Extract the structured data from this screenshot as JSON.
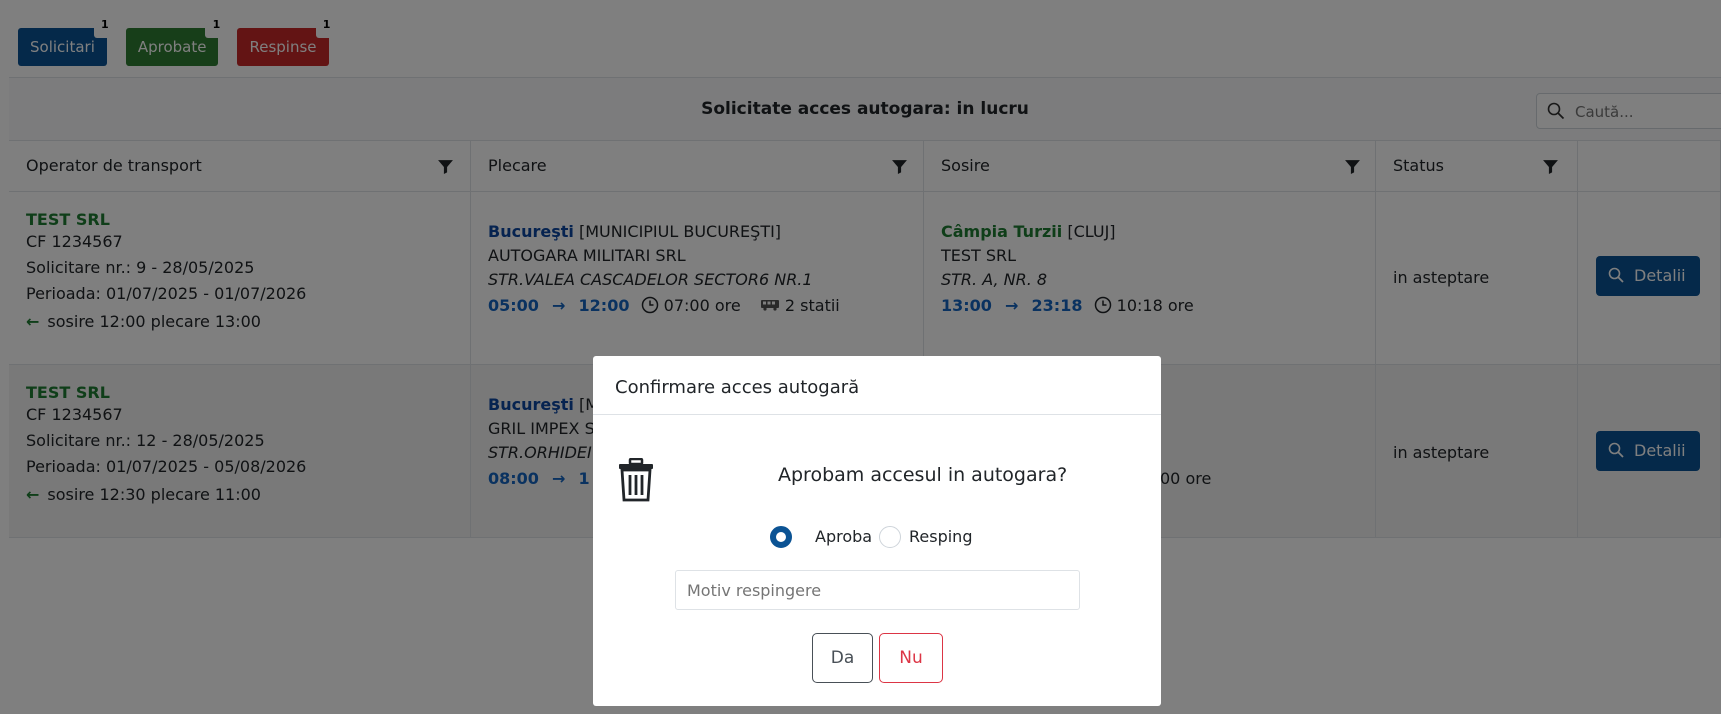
{
  "tabs": [
    {
      "label": "Solicitari",
      "badge": "1",
      "color": "#0b5394"
    },
    {
      "label": "Aprobate",
      "badge": "1",
      "color": "#2e7d32"
    },
    {
      "label": "Respinse",
      "badge": "1",
      "color": "#c62828"
    }
  ],
  "panel": {
    "title": "Solicitate acces autogara: in lucru",
    "search_placeholder": "Caută..."
  },
  "columns": {
    "operator": "Operator de transport",
    "plecare": "Plecare",
    "sosire": "Sosire",
    "status": "Status"
  },
  "rows": [
    {
      "operator": {
        "name": "TEST SRL",
        "cf": "CF 1234567",
        "solicitare": "Solicitare nr.:  9  -  28/05/2025",
        "perioada": "Perioada:  01/07/2025  -  01/07/2026",
        "arrow": "←",
        "sosire_plecare": "sosire 12:00 plecare 13:00"
      },
      "plecare": {
        "city": "Bucureşti",
        "county": " [MUNICIPIUL BUCUREŞTI]",
        "company": "AUTOGARA MILITARI SRL",
        "address": "STR.VALEA CASCADELOR SECTOR6 NR.1",
        "time_from": "05:00",
        "arrow": "→",
        "time_to": "12:00",
        "duration": "07:00 ore",
        "stations": "2 statii"
      },
      "sosire": {
        "city": "Câmpia Turzii",
        "county": " [CLUJ]",
        "company": "TEST SRL",
        "address": "STR. A, NR. 8",
        "time_from": "13:00",
        "arrow": "→",
        "time_to": "23:18",
        "duration": "10:18 ore"
      },
      "status": "in asteptare",
      "detalii_label": "Detalii"
    },
    {
      "operator": {
        "name": "TEST SRL",
        "cf": "CF 1234567",
        "solicitare": "Solicitare nr.:  12  -  28/05/2025",
        "perioada": "Perioada:  01/07/2025  -  05/08/2026",
        "arrow": "←",
        "sosire_plecare": "sosire 12:30 plecare 11:00"
      },
      "plecare": {
        "city": "Bucureşti",
        "county": " [M",
        "company": "GRIL IMPEX S",
        "address": "STR.ORHIDEI",
        "time_from": "08:00",
        "arrow": "→",
        "time_to": "1"
      },
      "sosire": {
        "duration_fragment": "00 ore"
      },
      "status": "in asteptare",
      "detalii_label": "Detalii"
    }
  ],
  "modal": {
    "title": "Confirmare acces autogară",
    "question": "Aprobam accesul in autogara?",
    "radio_aproba": "Aproba",
    "radio_resping": "Resping",
    "motiv_placeholder": "Motiv respingere",
    "btn_da": "Da",
    "btn_nu": "Nu"
  }
}
